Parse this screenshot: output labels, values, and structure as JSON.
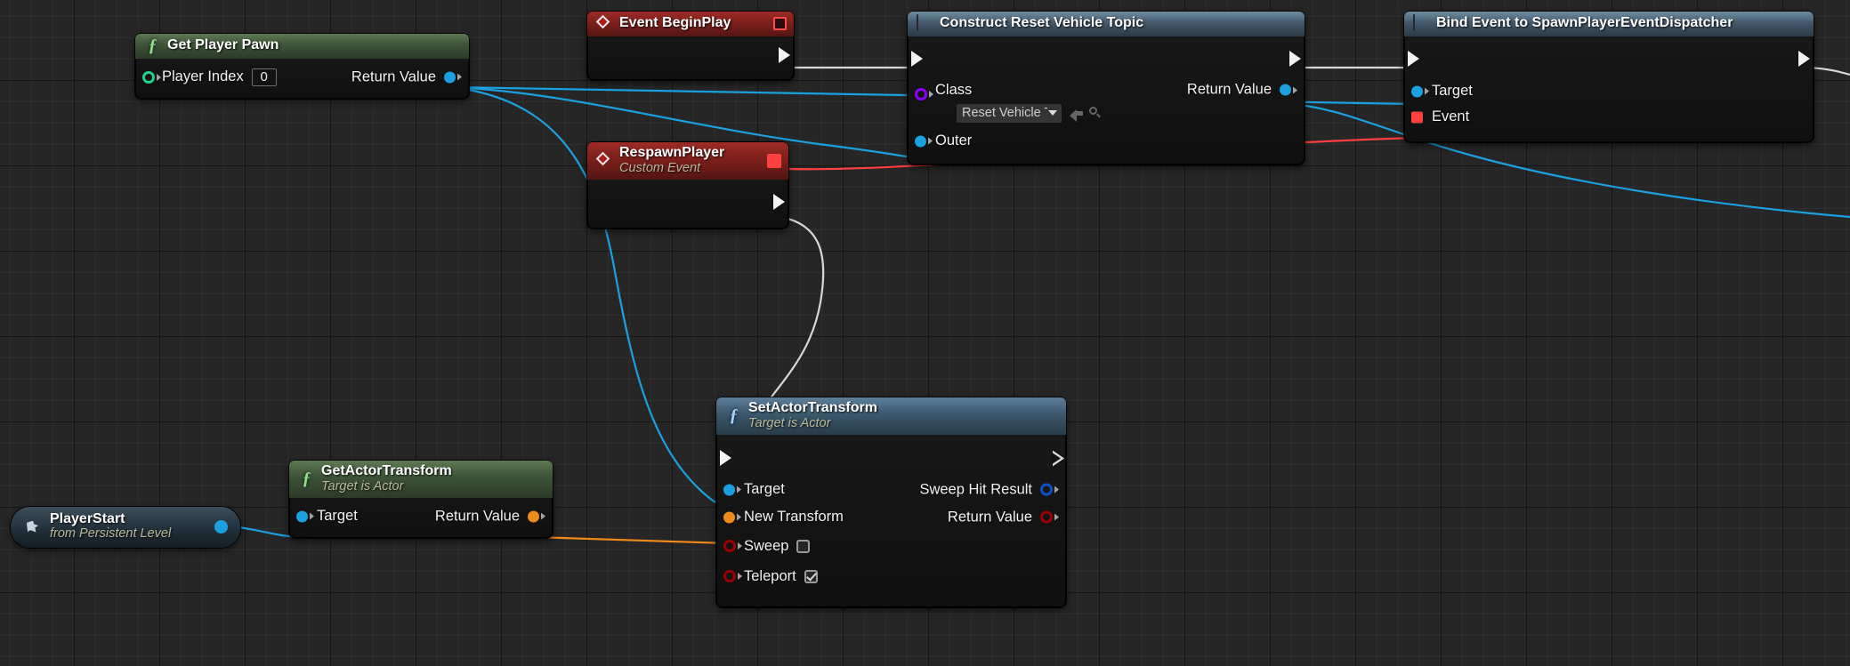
{
  "app": {
    "name": "Unreal Engine Blueprint Event Graph",
    "canvas_background": "#262626",
    "grid_minor": "#2e2e2e",
    "grid_major": "#101010"
  },
  "colors": {
    "exec_wire": "#d8d8d8",
    "object_wire": "#1ba1e2",
    "class_wire": "#7a0fd0",
    "delegate_wire": "#ff4040",
    "struct_wire": "#ef8b1c",
    "pin_object": "#1ba1e2",
    "pin_int": "#1fd18a",
    "pin_class": "#8c00ff",
    "pin_bool": "#9c0000",
    "pin_struct": "#ef8b1c",
    "pin_delegate": "#ff4040",
    "pin_hit_result": "#0b4fc4"
  },
  "nodes": {
    "get_player_pawn": {
      "title": "Get Player Pawn",
      "icon": "function-f-icon",
      "inputs": [
        {
          "label": "Player Index",
          "pin": "int-pin",
          "value": "0"
        }
      ],
      "outputs": [
        {
          "label": "Return Value",
          "pin": "object-pin"
        }
      ]
    },
    "event_begin_play": {
      "title": "Event BeginPlay",
      "icon": "event-diamond-icon",
      "badge": "node-stop-badge",
      "outputs": [
        {
          "label": "",
          "pin": "exec-pin"
        }
      ]
    },
    "respawn_player": {
      "title": "RespawnPlayer",
      "subtitle": "Custom Event",
      "icon": "custom-event-diamond-icon",
      "badge": "delegate-output-badge",
      "outputs": [
        {
          "label": "",
          "pin": "exec-pin"
        }
      ]
    },
    "construct_reset_vehicle_topic": {
      "title": "Construct Reset Vehicle Topic",
      "icon": "construct-object-icon",
      "inputs": [
        {
          "label": "",
          "pin": "exec-pin"
        },
        {
          "label": "Class",
          "pin": "class-pin",
          "value": "Reset Vehicle To",
          "widget": "class-dropdown"
        },
        {
          "label": "Outer",
          "pin": "object-pin"
        }
      ],
      "outputs": [
        {
          "label": "",
          "pin": "exec-pin"
        },
        {
          "label": "Return Value",
          "pin": "object-pin"
        }
      ]
    },
    "bind_event": {
      "title": "Bind Event to SpawnPlayerEventDispatcher",
      "icon": "construct-object-icon",
      "inputs": [
        {
          "label": "",
          "pin": "exec-pin"
        },
        {
          "label": "Target",
          "pin": "object-pin"
        },
        {
          "label": "Event",
          "pin": "delegate-pin"
        }
      ],
      "outputs": [
        {
          "label": "",
          "pin": "exec-pin"
        }
      ]
    },
    "set_actor_transform": {
      "title": "SetActorTransform",
      "subtitle": "Target is Actor",
      "icon": "function-f-icon",
      "inputs": [
        {
          "label": "",
          "pin": "exec-pin"
        },
        {
          "label": "Target",
          "pin": "object-pin"
        },
        {
          "label": "New Transform",
          "pin": "struct-pin"
        },
        {
          "label": "Sweep",
          "pin": "bool-pin",
          "widget": "checkbox",
          "checked": false
        },
        {
          "label": "Teleport",
          "pin": "bool-pin",
          "widget": "checkbox",
          "checked": true
        }
      ],
      "outputs": [
        {
          "label": "",
          "pin": "exec-pin"
        },
        {
          "label": "Sweep Hit Result",
          "pin": "hit-result-pin"
        },
        {
          "label": "Return Value",
          "pin": "bool-pin"
        }
      ]
    },
    "get_actor_transform": {
      "title": "GetActorTransform",
      "subtitle": "Target is Actor",
      "icon": "function-f-icon",
      "inputs": [
        {
          "label": "Target",
          "pin": "object-pin"
        }
      ],
      "outputs": [
        {
          "label": "Return Value",
          "pin": "struct-pin"
        }
      ]
    },
    "player_start": {
      "title": "PlayerStart",
      "subtitle": "from Persistent Level",
      "icon": "actor-reference-icon",
      "outputs": [
        {
          "label": "",
          "pin": "object-pin"
        }
      ]
    }
  }
}
